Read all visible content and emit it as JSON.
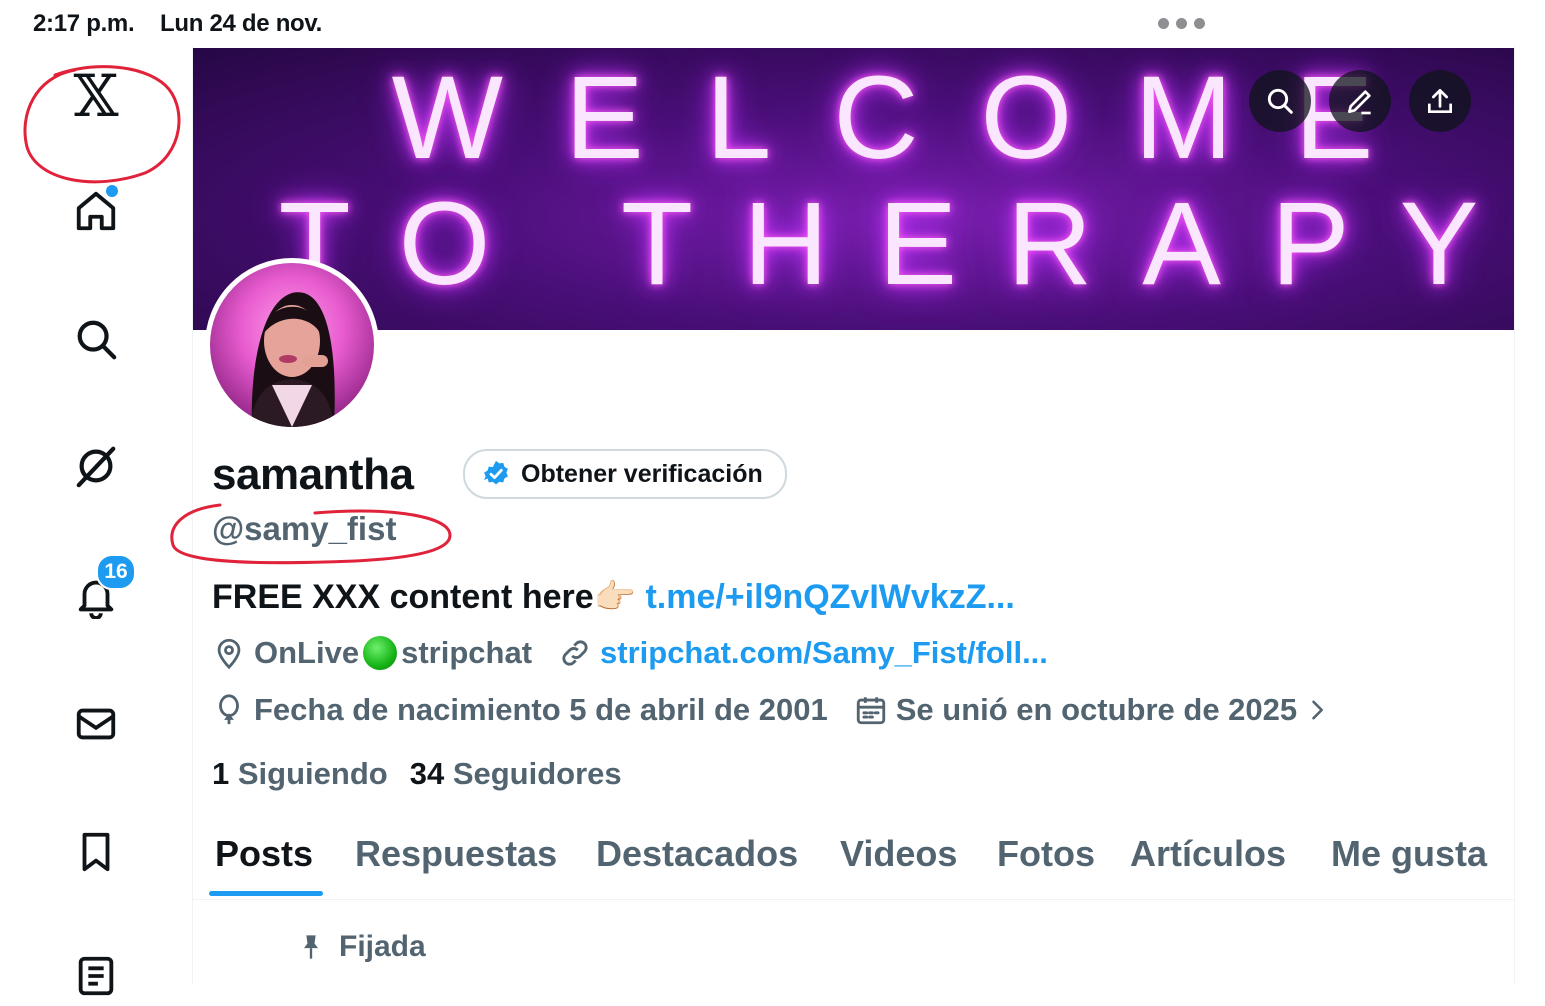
{
  "status_bar": {
    "time": "2:17 p.m.",
    "date": "Lun 24 de nov."
  },
  "sidebar": {
    "logo": "𝕏",
    "items": [
      {
        "name": "home",
        "icon": "home-icon",
        "has_dot": true
      },
      {
        "name": "explore",
        "icon": "search-icon"
      },
      {
        "name": "grok",
        "icon": "grok-icon"
      },
      {
        "name": "notifications",
        "icon": "bell-icon",
        "badge": "16"
      },
      {
        "name": "messages",
        "icon": "mail-icon"
      },
      {
        "name": "bookmarks",
        "icon": "bookmark-icon"
      },
      {
        "name": "lists",
        "icon": "list-icon"
      }
    ]
  },
  "banner": {
    "line1": "WELCOME",
    "line2": "TO THERAPY",
    "colors": {
      "base": "#4a0f79",
      "glow": "#d63cff"
    }
  },
  "profile": {
    "display_name": "samantha",
    "verify_label": "Obtener verificación",
    "handle": "@samy_fist",
    "bio_text": "FREE XXX content here👉🏻",
    "bio_link": "t.me/+il9nQZvIWvkzZ...",
    "location_before": "OnLive",
    "location_after": "stripchat",
    "website": "stripchat.com/Samy_Fist/foll...",
    "birthday": "Fecha de nacimiento 5 de abril de 2001",
    "joined": "Se unió en octubre de 2025",
    "following_count": "1",
    "following_label": "Siguiendo",
    "followers_count": "34",
    "followers_label": "Seguidores"
  },
  "tabs": [
    "Posts",
    "Respuestas",
    "Destacados",
    "Videos",
    "Fotos",
    "Artículos",
    "Me gusta"
  ],
  "active_tab": "Posts",
  "pinned_label": "Fijada",
  "colors": {
    "accent": "#1d9bf0",
    "text": "#0f1419",
    "secondary": "#536471",
    "annotation": "#e0223a"
  }
}
